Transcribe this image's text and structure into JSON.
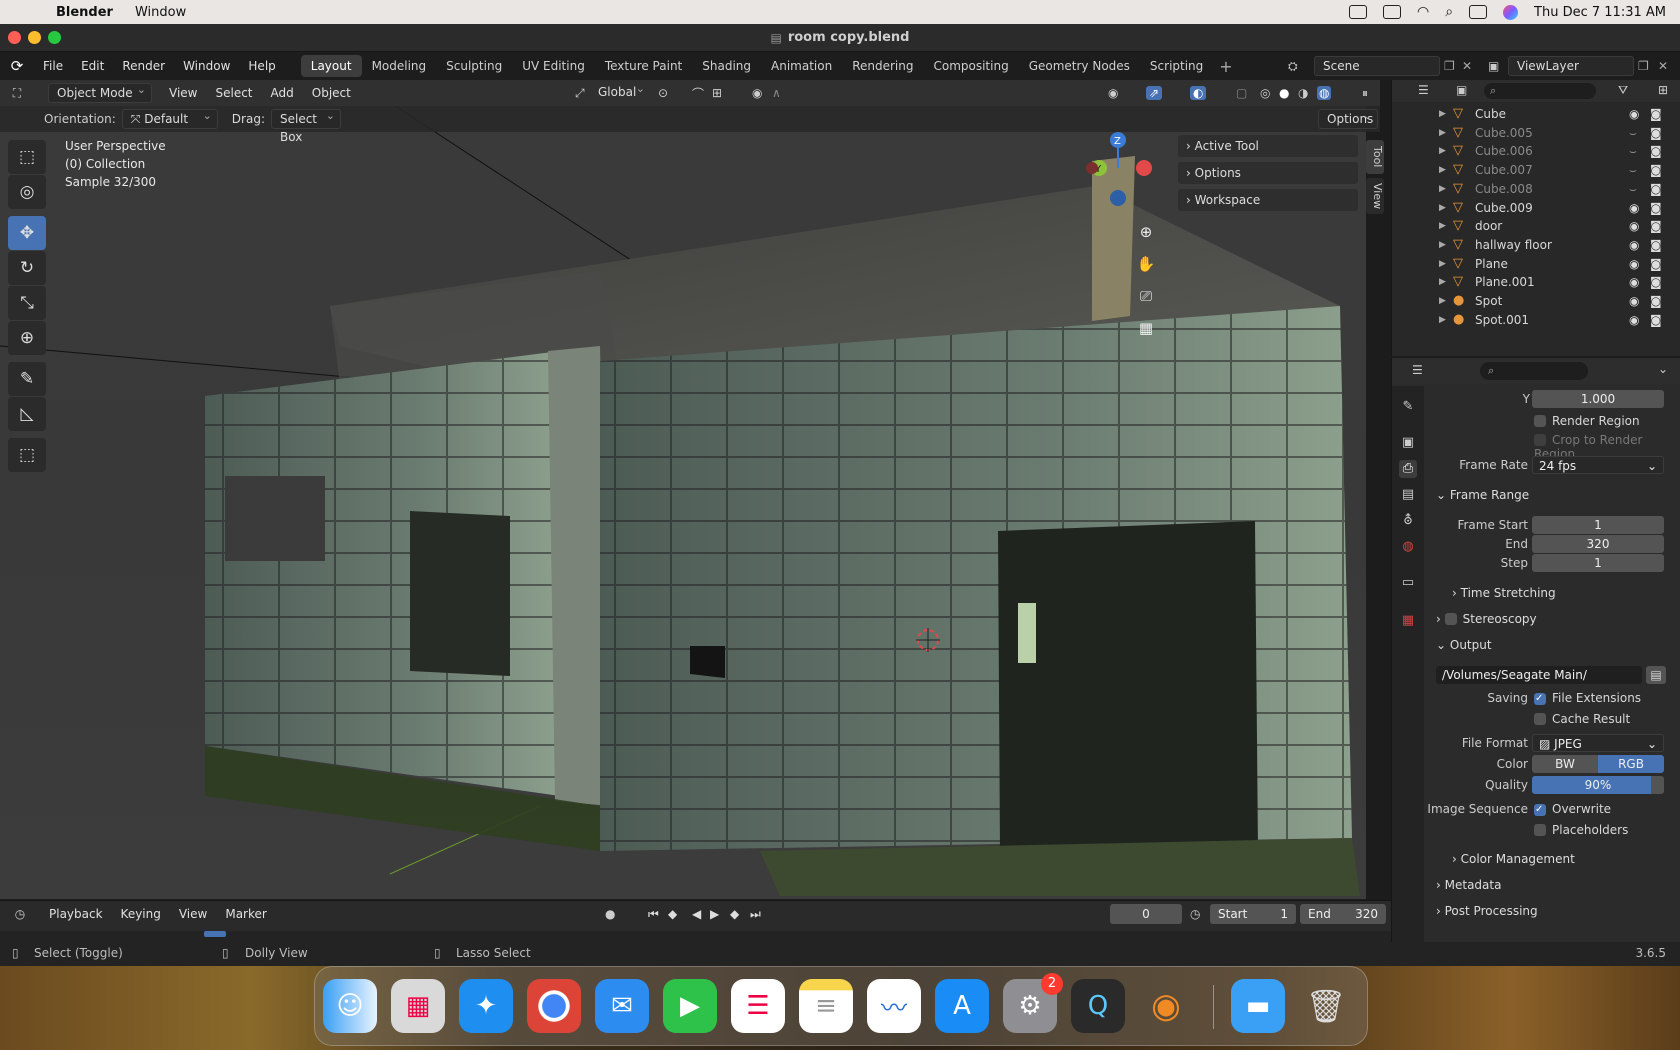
{
  "mac_menubar": {
    "app_name": "Blender",
    "menu": [
      "Window"
    ],
    "datetime": "Thu Dec 7  11:31 AM"
  },
  "window": {
    "title": "room copy.blend"
  },
  "topbar": {
    "menus": [
      "File",
      "Edit",
      "Render",
      "Window",
      "Help"
    ],
    "workspaces": [
      "Layout",
      "Modeling",
      "Sculpting",
      "UV Editing",
      "Texture Paint",
      "Shading",
      "Animation",
      "Rendering",
      "Compositing",
      "Geometry Nodes",
      "Scripting"
    ],
    "active_workspace": "Layout",
    "scene": "Scene",
    "view_layer": "ViewLayer"
  },
  "viewport_header": {
    "mode": "Object Mode",
    "menus": [
      "View",
      "Select",
      "Add",
      "Object"
    ],
    "transform_orientation": "Global",
    "orientation_label": "Orientation:",
    "orientation_value": "Default",
    "drag_label": "Drag:",
    "drag_value": "Select Box",
    "options": "Options"
  },
  "viewport": {
    "perspective": "User Perspective",
    "collection": "(0) Collection",
    "sample": "Sample 32/300",
    "npanel": [
      "Active Tool",
      "Options",
      "Workspace"
    ],
    "side_tabs": [
      "Tool",
      "View"
    ],
    "gizmo_axes": [
      "Z",
      "Y"
    ]
  },
  "outliner": {
    "items": [
      {
        "name": "Cube",
        "visible": true,
        "type": "mesh"
      },
      {
        "name": "Cube.005",
        "visible": false,
        "type": "mesh"
      },
      {
        "name": "Cube.006",
        "visible": false,
        "type": "mesh"
      },
      {
        "name": "Cube.007",
        "visible": false,
        "type": "mesh"
      },
      {
        "name": "Cube.008",
        "visible": false,
        "type": "mesh"
      },
      {
        "name": "Cube.009",
        "visible": true,
        "type": "mesh"
      },
      {
        "name": "door",
        "visible": true,
        "type": "mesh"
      },
      {
        "name": "hallway floor",
        "visible": true,
        "type": "mesh"
      },
      {
        "name": "Plane",
        "visible": true,
        "type": "mesh"
      },
      {
        "name": "Plane.001",
        "visible": true,
        "type": "mesh"
      },
      {
        "name": "Spot",
        "visible": true,
        "type": "light"
      },
      {
        "name": "Spot.001",
        "visible": true,
        "type": "light"
      }
    ]
  },
  "properties": {
    "y_label": "Y",
    "y_value": "1.000",
    "render_region": "Render Region",
    "crop_region": "Crop to Render Region",
    "frame_rate_label": "Frame Rate",
    "frame_rate": "24 fps",
    "frame_range_header": "Frame Range",
    "frame_start_label": "Frame Start",
    "frame_start": "1",
    "end_label": "End",
    "end": "320",
    "step_label": "Step",
    "step": "1",
    "time_stretching": "Time Stretching",
    "stereoscopy": "Stereoscopy",
    "output_header": "Output",
    "output_path": "/Volumes/Seagate Main/",
    "saving_label": "Saving",
    "file_extensions": "File Extensions",
    "cache_result": "Cache Result",
    "file_format_label": "File Format",
    "file_format": "JPEG",
    "color_label": "Color",
    "color_bw": "BW",
    "color_rgb": "RGB",
    "quality_label": "Quality",
    "quality": "90%",
    "quality_fraction": 0.9,
    "image_sequence_label": "Image Sequence",
    "overwrite": "Overwrite",
    "placeholders": "Placeholders",
    "color_management": "Color Management",
    "metadata": "Metadata",
    "post_processing": "Post Processing"
  },
  "timeline": {
    "menus": [
      "Playback",
      "Keying",
      "View",
      "Marker"
    ],
    "current_frame": "0",
    "start_label": "Start",
    "start": "1",
    "end_label": "End",
    "end": "320"
  },
  "statusbar": {
    "hints": [
      "Select (Toggle)",
      "Dolly View",
      "Lasso Select"
    ],
    "version": "3.6.5"
  },
  "dock": {
    "settings_badge": "2"
  },
  "colors": {
    "accent": "#4772b3",
    "header_bg": "#303030",
    "panel_bg": "#2b2b2b"
  }
}
